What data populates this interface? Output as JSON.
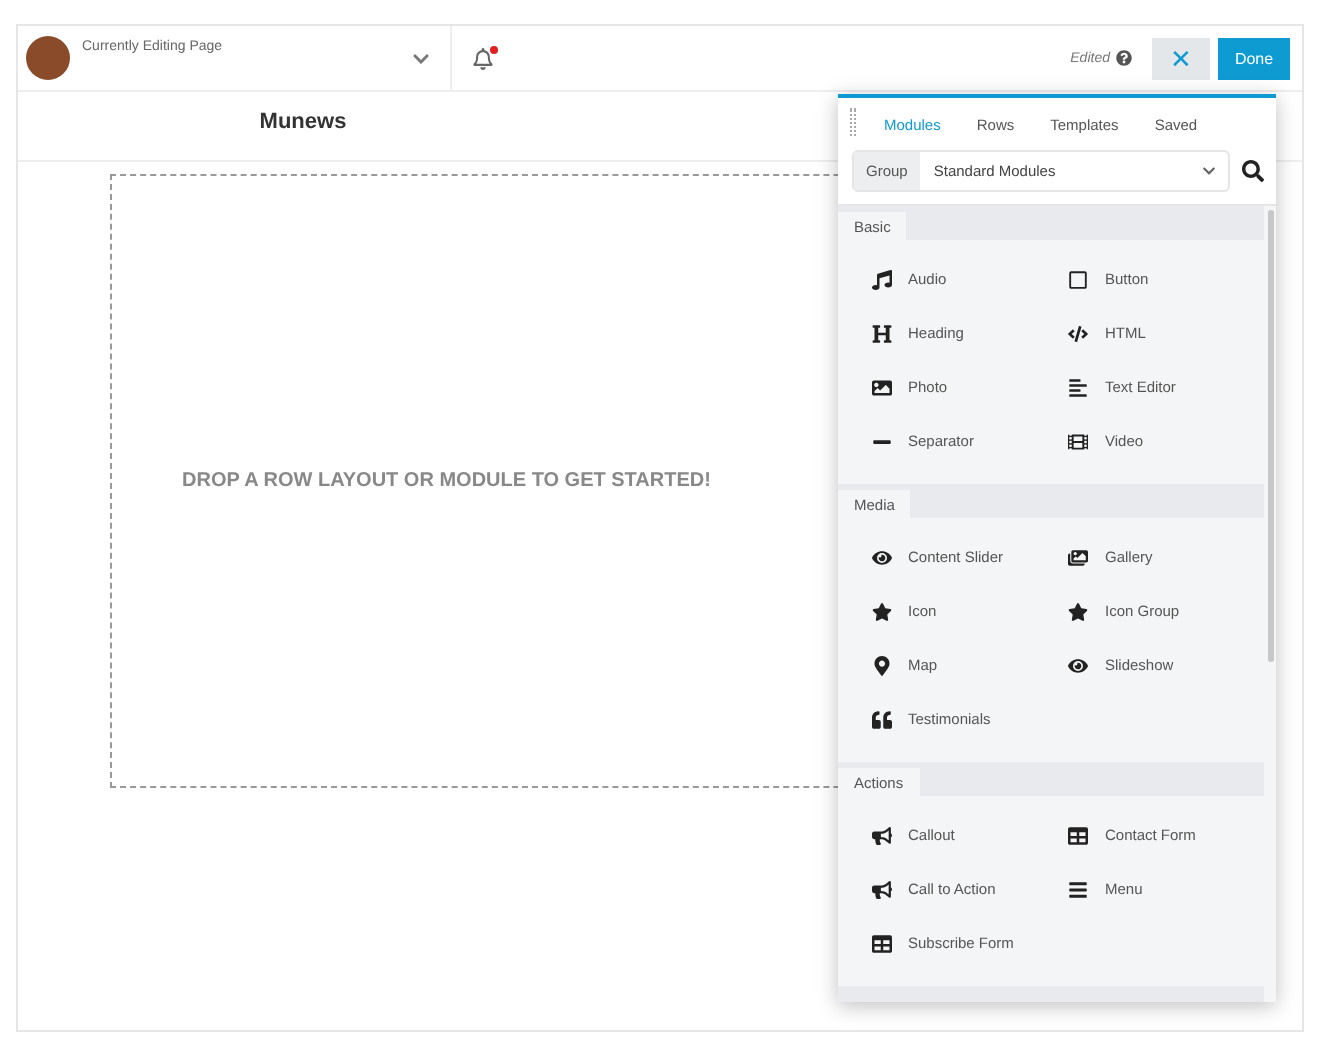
{
  "topbar": {
    "page_label": "Currently Editing Page",
    "notification": true,
    "status": "Edited",
    "close_label": "✕",
    "done_label": "Done"
  },
  "canvas": {
    "title": "Munews",
    "drop_hint": "DROP A ROW LAYOUT OR MODULE TO GET STARTED!"
  },
  "panel": {
    "tabs": [
      {
        "label": "Modules",
        "selected": true
      },
      {
        "label": "Rows",
        "selected": false
      },
      {
        "label": "Templates",
        "selected": false
      },
      {
        "label": "Saved",
        "selected": false
      }
    ],
    "group_label": "Group",
    "group_value": "Standard Modules",
    "sections": [
      {
        "title": "Basic",
        "items": [
          "Audio",
          "Button",
          "Heading",
          "HTML",
          "Photo",
          "Text Editor",
          "Separator",
          "Video"
        ]
      },
      {
        "title": "Media",
        "items": [
          "Content Slider",
          "Gallery",
          "Icon",
          "Icon Group",
          "Map",
          "Slideshow",
          "Testimonials"
        ]
      },
      {
        "title": "Actions",
        "items": [
          "Callout",
          "Contact Form",
          "Call to Action",
          "Menu",
          "Subscribe Form"
        ]
      }
    ]
  }
}
